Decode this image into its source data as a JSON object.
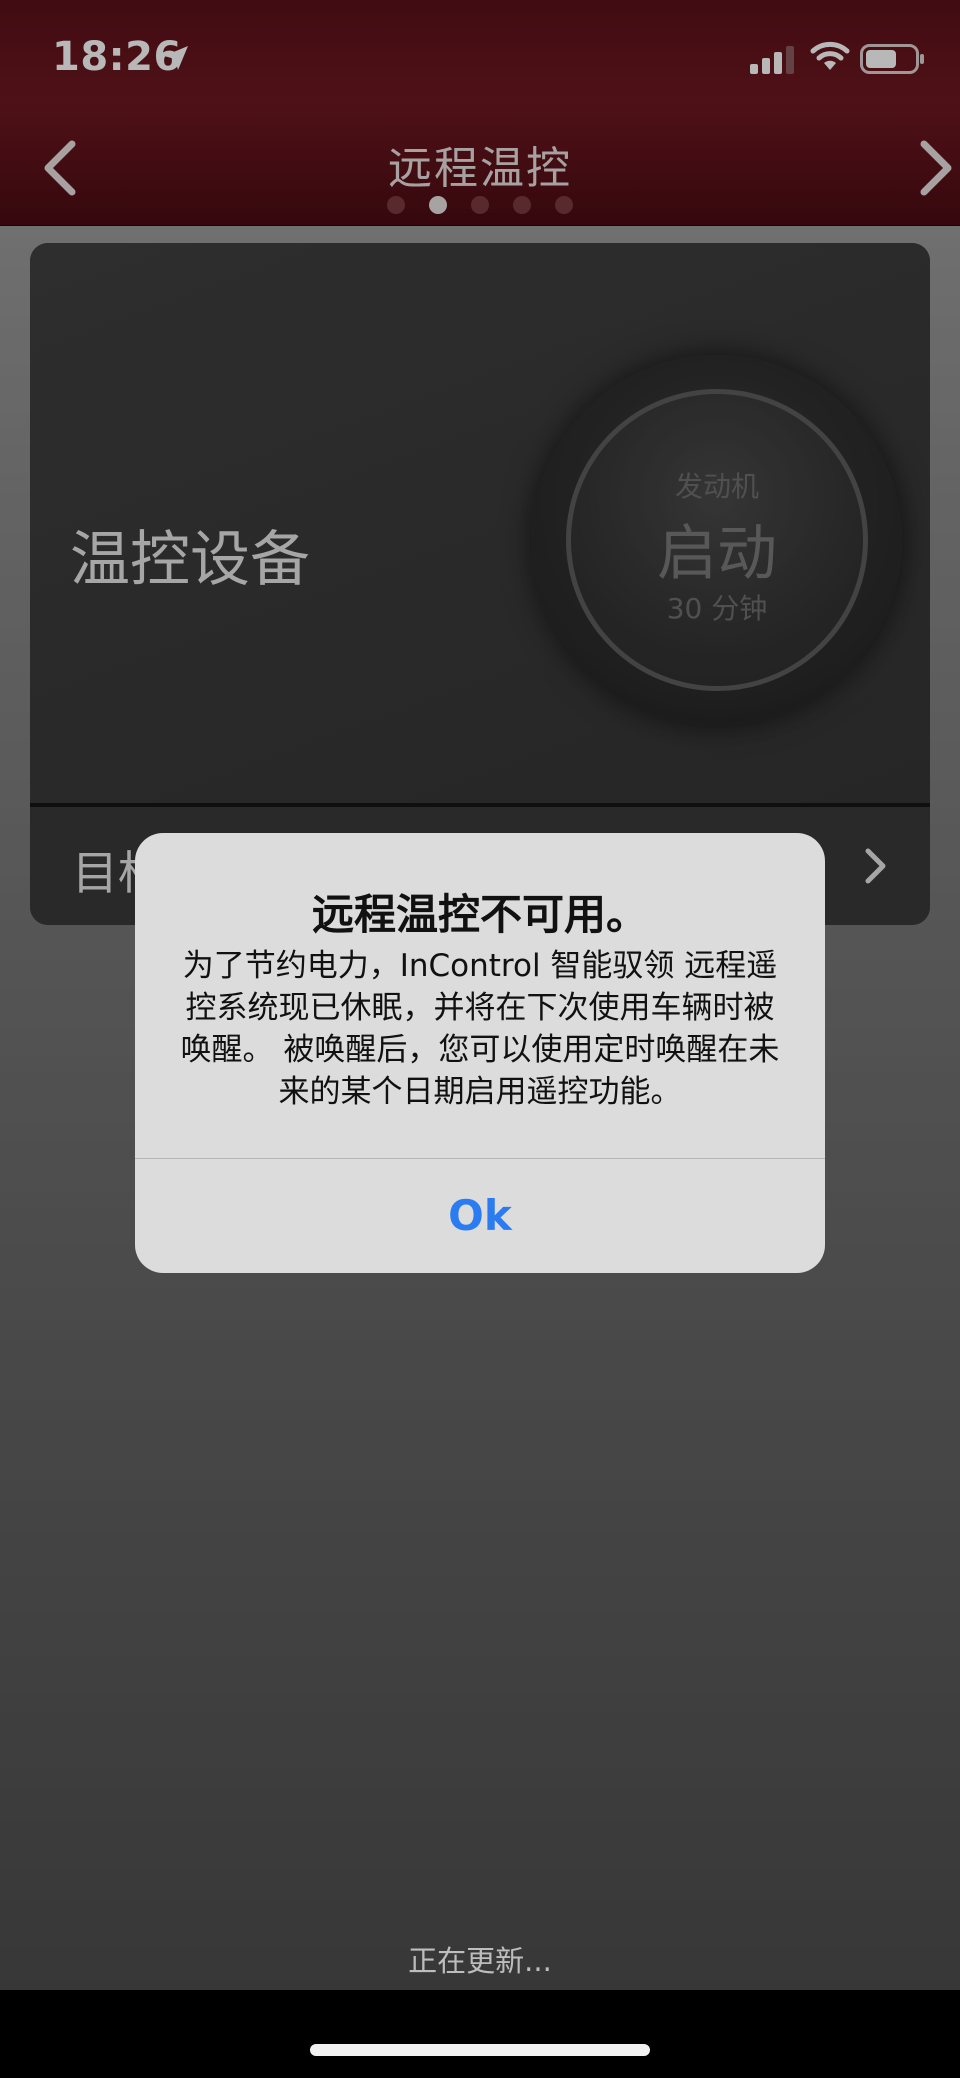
{
  "status_bar": {
    "time": "18:26"
  },
  "nav": {
    "title": "远程温控",
    "page_dots": 5,
    "active_dot": 2
  },
  "card": {
    "label": "温控设备",
    "knob": {
      "line1": "发动机",
      "line2": "启动",
      "line3": "30 分钟"
    },
    "target_label_visible": "目标"
  },
  "alert": {
    "title": "远程温控不可用。",
    "message": "为了节约电力，InControl 智能驭领 远程遥控系统现已休眠，并将在下次使用车辆时被唤醒。 被唤醒后，您可以使用定时唤醒在未来的某个日期启用遥控功能。",
    "ok_label": "Ok"
  },
  "footer": {
    "status": "正在更新..."
  },
  "colors": {
    "header": "#6e1821",
    "accent_ok": "#2b7cf0"
  }
}
